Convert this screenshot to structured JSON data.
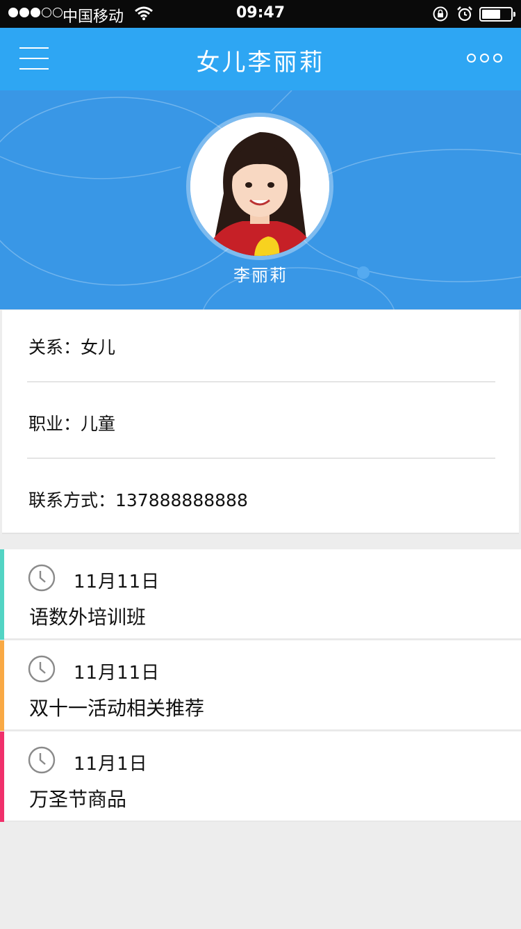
{
  "status_bar": {
    "carrier": "中国移动",
    "time": "09:47",
    "signal_strength": 3,
    "signal_total": 5,
    "battery_level": 0.55
  },
  "nav": {
    "title": "女儿李丽莉",
    "menu_icon": "hamburger-menu-icon",
    "more_icon": "more-dots-icon",
    "color": "#2ea6f3"
  },
  "profile": {
    "name": "李丽莉",
    "background_color": "#3997e6"
  },
  "info": {
    "relation": "关系：女儿",
    "occupation": "职业：儿童",
    "contact": "联系方式：137888888888"
  },
  "events": [
    {
      "date": "11月11日",
      "title": "语数外培训班",
      "color": "#53d4c4"
    },
    {
      "date": "11月11日",
      "title": "双十一活动相关推荐",
      "color": "#f9a944"
    },
    {
      "date": "11月1日",
      "title": "万圣节商品",
      "color": "#f0306b"
    }
  ]
}
